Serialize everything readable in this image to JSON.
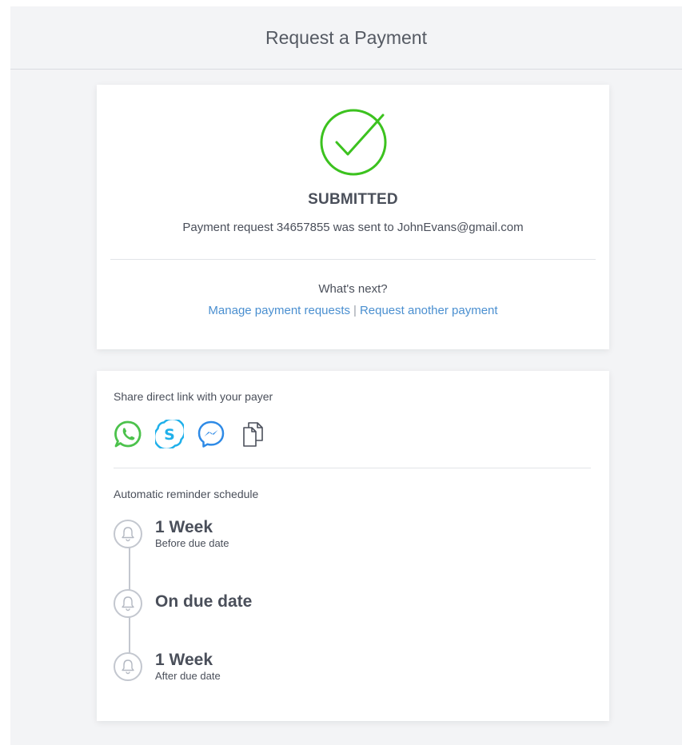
{
  "header": {
    "title": "Request a Payment"
  },
  "status": {
    "title": "SUBMITTED",
    "message": "Payment request 34657855 was sent to JohnEvans@gmail.com",
    "next_label": "What's next?",
    "links": {
      "manage": "Manage payment requests",
      "separator": "|",
      "another": "Request another payment"
    },
    "check_color": "#3cc21f",
    "link_color": "#4a8fd0"
  },
  "share": {
    "label": "Share direct link with your payer",
    "icons": [
      "whatsapp-icon",
      "skype-icon",
      "messenger-icon",
      "copy-icon"
    ]
  },
  "reminders": {
    "label": "Automatic reminder schedule",
    "items": [
      {
        "title": "1 Week",
        "subtitle": "Before due date"
      },
      {
        "title": "On due date",
        "subtitle": ""
      },
      {
        "title": "1 Week",
        "subtitle": "After due date"
      }
    ]
  }
}
